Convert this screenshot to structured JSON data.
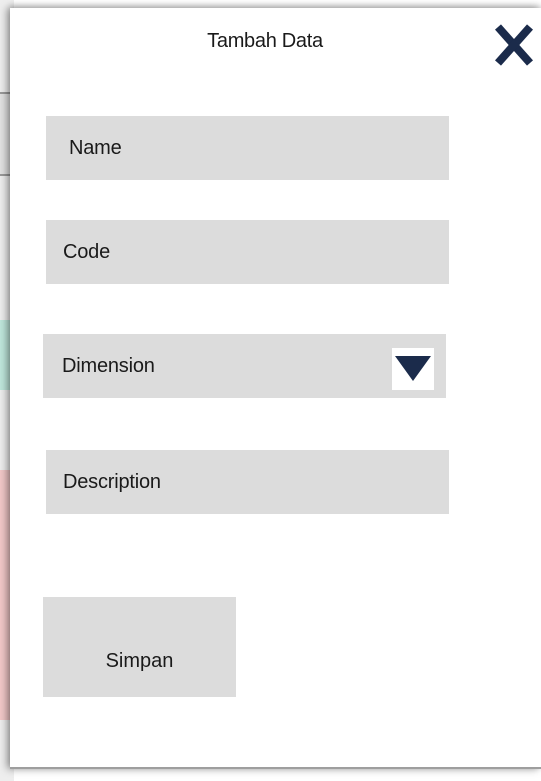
{
  "modal": {
    "title": "Tambah Data",
    "close_icon": "close-icon"
  },
  "form": {
    "fields": [
      {
        "id": "name",
        "placeholder": "Name"
      },
      {
        "id": "code",
        "placeholder": "Code"
      },
      {
        "id": "dimension",
        "placeholder": "Dimension",
        "dropdown_icon": "chevron-down-icon"
      },
      {
        "id": "description",
        "placeholder": "Description"
      }
    ],
    "save_label": "Simpan"
  },
  "colors": {
    "accent": "#1b2b4b",
    "field_bg": "#dcdcdc"
  }
}
